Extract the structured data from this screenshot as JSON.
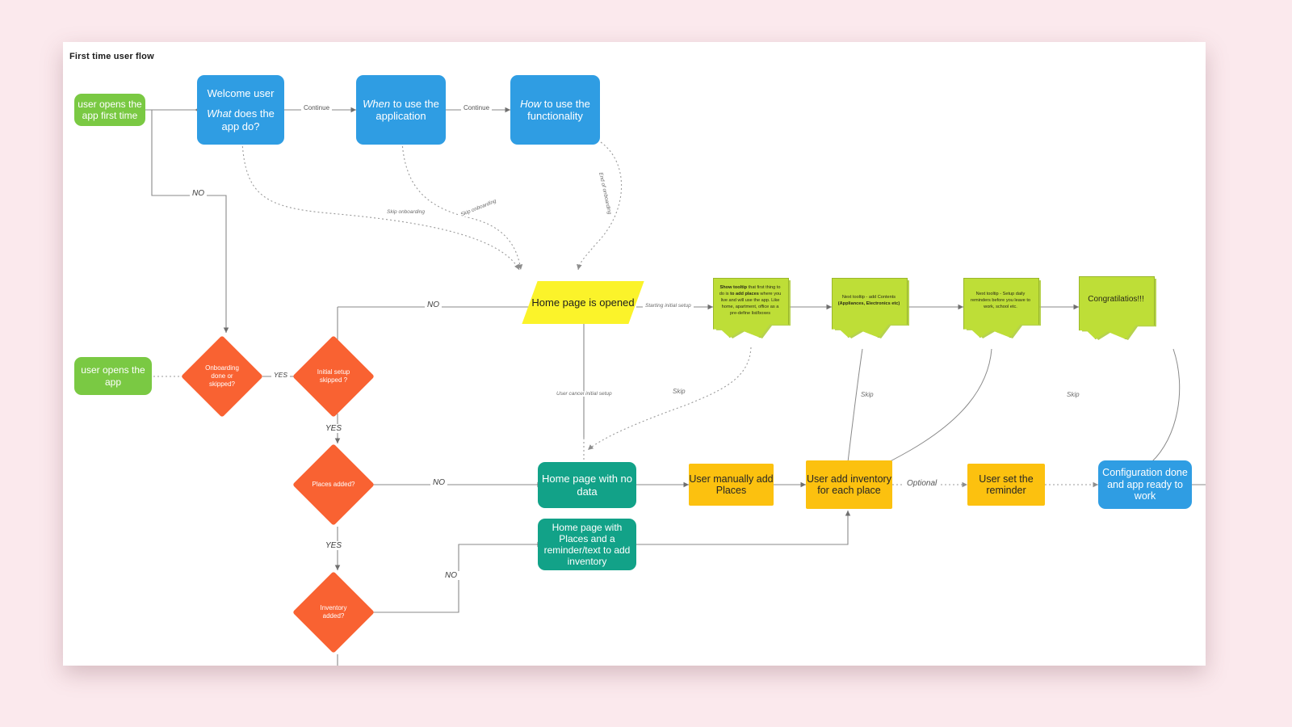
{
  "board": {
    "title": "First time user flow",
    "background_color": "#fbe9ed",
    "canvas_color": "#ffffff"
  },
  "palette": {
    "green": "#7ac943",
    "blue": "#2f9de3",
    "teal": "#12a288",
    "orange_diamond": "#f96232",
    "yellow_parallelogram": "#fbf32a",
    "yellow_rect": "#fcc10f",
    "note_green": "#bede37"
  },
  "nodes": {
    "start_first_time": "user opens the app first time",
    "welcome_title": "Welcome user",
    "welcome_q_em": "What",
    "welcome_q_rest": " does the app do?",
    "when_em": "When",
    "when_rest": " to use the application",
    "how_em": "How",
    "how_rest": " to use the functionality",
    "start_returning": "user opens the app",
    "d_onboarding": "Onboarding done or skipped?",
    "d_initial_setup": "Initial setup skipped ?",
    "d_places_added": "Places added?",
    "d_inventory_added": "Inventory added?",
    "home_page_opened": "Home page is opened",
    "home_no_data": "Home page with no data",
    "home_with_places": "Home page with Places and a reminder/text to add inventory",
    "user_add_places": "User manually add Places",
    "user_add_inventory": "User add inventory for each place",
    "user_set_reminder": "User set the reminder",
    "config_done": "Configuration done and app ready to work",
    "note1": {
      "b1": "Show tooltip",
      "t1": " that first thing to do is ",
      "b2": "to add places",
      "t2": " where you live and will use the app. Like home, apartment, office as a pre-define list/boxes"
    },
    "note2": {
      "t1": "Next tooltip - add Contents ",
      "b1": "(Appliances, Electronics etc)"
    },
    "note3": {
      "t1": "Next tooltip -  Setup daily reminders before you leave to work, school etc."
    },
    "note4": {
      "t1": "Congratilatios!!!"
    }
  },
  "edge_labels": {
    "continue_1": "Continue",
    "continue_2": "Continue",
    "no_1": "NO",
    "no_2": "NO",
    "no_3": "NO",
    "no_4": "NO",
    "yes_1": "YES",
    "yes_2": "YES",
    "yes_3": "YES",
    "skip_onboarding_1": "Skip onboarding",
    "skip_onboarding_2": "Skip onboarding",
    "end_of_onboarding": "End of onboarding",
    "starting_initial_setup": "Starting initial setup",
    "user_cancel_initial_setup": "User cancel initial setup",
    "skip_1": "Skip",
    "skip_2": "Skip",
    "skip_3": "Skip",
    "optional": "Optional"
  }
}
